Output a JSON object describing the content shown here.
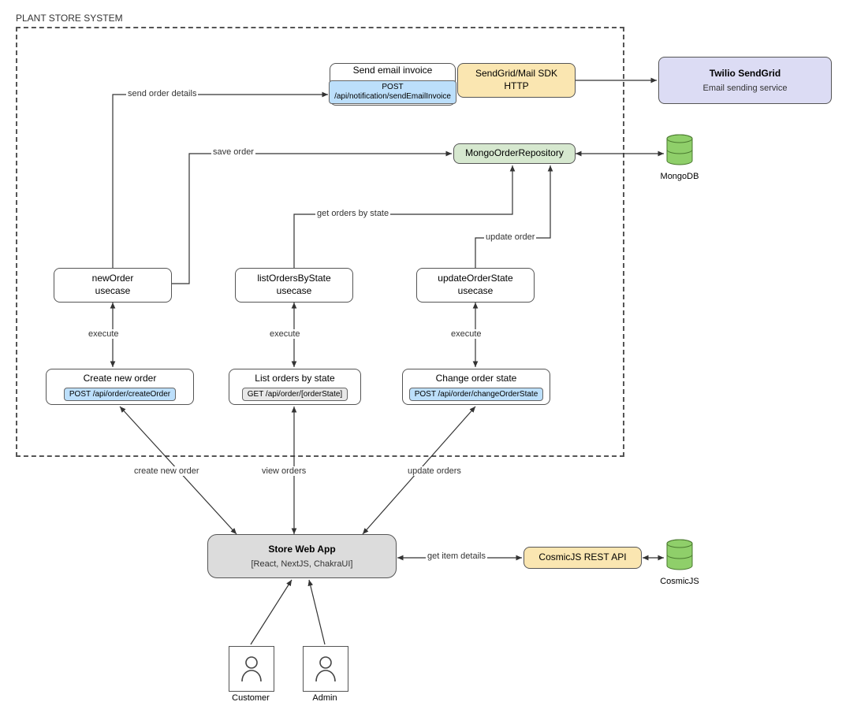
{
  "system": {
    "label": "PLANT STORE SYSTEM"
  },
  "sendEmail": {
    "title": "Send email invoice",
    "api": "POST /api/notification/sendEmailInvoice"
  },
  "sendgridSdk": {
    "line1": "SendGrid/Mail SDK",
    "line2": "HTTP"
  },
  "twilio": {
    "title": "Twilio SendGrid",
    "sub": "Email sending service"
  },
  "mongoRepo": {
    "title": "MongoOrderRepository"
  },
  "mongodb": {
    "label": "MongoDB"
  },
  "newOrderUC": {
    "line1": "newOrder",
    "line2": "usecase"
  },
  "listOrdersUC": {
    "line1": "listOrdersByState",
    "line2": "usecase"
  },
  "updateOrderUC": {
    "line1": "updateOrderState",
    "line2": "usecase"
  },
  "createOrder": {
    "title": "Create new order",
    "api": "POST /api/order/createOrder"
  },
  "listOrders": {
    "title": "List orders by state",
    "api": "GET /api/order/[orderState]"
  },
  "changeOrder": {
    "title": "Change order state",
    "api": "POST /api/order/changeOrderState"
  },
  "webapp": {
    "title": "Store Web App",
    "sub": "[React, NextJS, ChakraUI]"
  },
  "cosmicApi": {
    "title": "CosmicJS REST API"
  },
  "cosmicjs": {
    "label": "CosmicJS"
  },
  "actors": {
    "customer": "Customer",
    "admin": "Admin"
  },
  "edges": {
    "sendOrderDetails": "send order details",
    "saveOrder": "save order",
    "getOrdersByState": "get orders by state",
    "updateOrder": "update order",
    "execute1": "execute",
    "execute2": "execute",
    "execute3": "execute",
    "createNewOrder": "create new order",
    "viewOrders": "view orders",
    "updateOrders": "update orders",
    "getItemDetails": "get item details"
  }
}
